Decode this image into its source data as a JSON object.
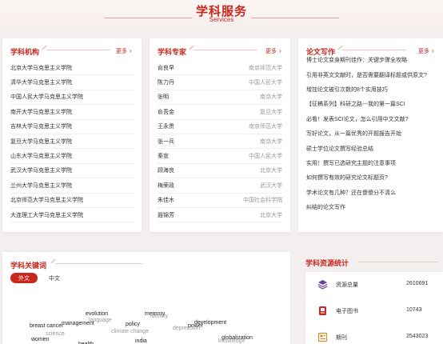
{
  "header": {
    "title": "学科服务",
    "subtitle": "Services"
  },
  "institutions": {
    "title": "学科机构",
    "more": "更多",
    "items": [
      "北京大学马克思主义学院",
      "清华大学马克思主义学院",
      "中国人民大学马克思主义学院",
      "南开大学马克思主义学院",
      "吉林大学马克思主义学院",
      "复旦大学马克思主义学院",
      "山东大学马克思主义学院",
      "武汉大学马克思主义学院",
      "兰州大学马克思主义学院",
      "北京师范大学马克思主义学院",
      "大连理工大学马克思主义学院"
    ]
  },
  "experts": {
    "title": "学科专家",
    "more": "更多",
    "items": [
      {
        "name": "俞良早",
        "org": "南京师范大学"
      },
      {
        "name": "陈力丹",
        "org": "中国人民大学"
      },
      {
        "name": "张明",
        "org": "南京大学"
      },
      {
        "name": "俞吾金",
        "org": "复旦大学"
      },
      {
        "name": "王永贵",
        "org": "南京师范大学"
      },
      {
        "name": "张一兵",
        "org": "南京大学"
      },
      {
        "name": "秦宣",
        "org": "中国人民大学"
      },
      {
        "name": "顾海良",
        "org": "北京大学"
      },
      {
        "name": "梅荣政",
        "org": "武汉大学"
      },
      {
        "name": "朱佳木",
        "org": "中国社会科学院"
      },
      {
        "name": "聂锦芳",
        "org": "北京大学"
      }
    ]
  },
  "writing": {
    "title": "论文写作",
    "more": "更多",
    "items": [
      "博士论文变身期刊佳作：关键步骤全攻略",
      "引用非英文文献时，是否需要翻译标题或供原文?",
      "增加论文被引次数的8个实用技巧",
      "【征稿系列】科研之路---我的第一篇SCI",
      "必看！发表SCI论文，怎么引用中文文献?",
      "写好论文，从一篇优秀的开题报告开始",
      "硕士学位论文撰写经验总结",
      "实用！撰写已选研究主题的注意事项",
      "如何撰写有效的研究论文标题页?",
      "学术论文有几种？还在傻傻分不清么",
      "纠结的论文写作"
    ]
  },
  "keywords": {
    "title": "学科关键词",
    "tabs": [
      "外文",
      "中文"
    ],
    "words": [
      {
        "text": "evolution",
        "light": false
      },
      {
        "text": "language",
        "light": true
      },
      {
        "text": "management",
        "light": false
      },
      {
        "text": "memory",
        "light": false
      },
      {
        "text": "identity",
        "light": true
      },
      {
        "text": "development",
        "light": false
      },
      {
        "text": "breast cancer",
        "light": false
      },
      {
        "text": "policy",
        "light": false
      },
      {
        "text": "power",
        "light": false
      },
      {
        "text": "depression",
        "light": true
      },
      {
        "text": "science",
        "light": true
      },
      {
        "text": "climate change",
        "light": true
      },
      {
        "text": "globalization",
        "light": false
      },
      {
        "text": "women",
        "light": false
      },
      {
        "text": "india",
        "light": false
      },
      {
        "text": "knowledge",
        "light": true
      },
      {
        "text": "health",
        "light": false
      }
    ]
  },
  "resources": {
    "title": "学科资源统计",
    "items": [
      {
        "label": "资源总量",
        "value": "2610691",
        "icon": "database-stack-icon",
        "color": "#6b3fa0"
      },
      {
        "label": "电子图书",
        "value": "10743",
        "icon": "ebook-icon",
        "color": "#c8281e"
      },
      {
        "label": "期刊",
        "value": "2543023",
        "icon": "journal-icon",
        "color": "#d98a2b"
      }
    ]
  },
  "colors": {
    "accent": "#c8281e",
    "background": "#f3efee"
  }
}
